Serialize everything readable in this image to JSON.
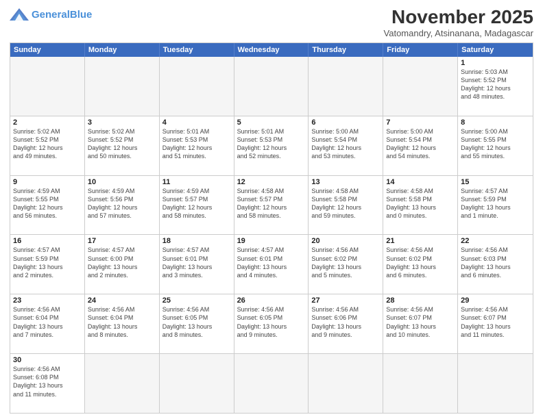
{
  "header": {
    "logo_general": "General",
    "logo_blue": "Blue",
    "month_title": "November 2025",
    "subtitle": "Vatomandry, Atsinanana, Madagascar"
  },
  "weekdays": [
    "Sunday",
    "Monday",
    "Tuesday",
    "Wednesday",
    "Thursday",
    "Friday",
    "Saturday"
  ],
  "rows": [
    [
      {
        "day": "",
        "info": ""
      },
      {
        "day": "",
        "info": ""
      },
      {
        "day": "",
        "info": ""
      },
      {
        "day": "",
        "info": ""
      },
      {
        "day": "",
        "info": ""
      },
      {
        "day": "",
        "info": ""
      },
      {
        "day": "1",
        "info": "Sunrise: 5:03 AM\nSunset: 5:52 PM\nDaylight: 12 hours\nand 48 minutes."
      }
    ],
    [
      {
        "day": "2",
        "info": "Sunrise: 5:02 AM\nSunset: 5:52 PM\nDaylight: 12 hours\nand 49 minutes."
      },
      {
        "day": "3",
        "info": "Sunrise: 5:02 AM\nSunset: 5:52 PM\nDaylight: 12 hours\nand 50 minutes."
      },
      {
        "day": "4",
        "info": "Sunrise: 5:01 AM\nSunset: 5:53 PM\nDaylight: 12 hours\nand 51 minutes."
      },
      {
        "day": "5",
        "info": "Sunrise: 5:01 AM\nSunset: 5:53 PM\nDaylight: 12 hours\nand 52 minutes."
      },
      {
        "day": "6",
        "info": "Sunrise: 5:00 AM\nSunset: 5:54 PM\nDaylight: 12 hours\nand 53 minutes."
      },
      {
        "day": "7",
        "info": "Sunrise: 5:00 AM\nSunset: 5:54 PM\nDaylight: 12 hours\nand 54 minutes."
      },
      {
        "day": "8",
        "info": "Sunrise: 5:00 AM\nSunset: 5:55 PM\nDaylight: 12 hours\nand 55 minutes."
      }
    ],
    [
      {
        "day": "9",
        "info": "Sunrise: 4:59 AM\nSunset: 5:55 PM\nDaylight: 12 hours\nand 56 minutes."
      },
      {
        "day": "10",
        "info": "Sunrise: 4:59 AM\nSunset: 5:56 PM\nDaylight: 12 hours\nand 57 minutes."
      },
      {
        "day": "11",
        "info": "Sunrise: 4:59 AM\nSunset: 5:57 PM\nDaylight: 12 hours\nand 58 minutes."
      },
      {
        "day": "12",
        "info": "Sunrise: 4:58 AM\nSunset: 5:57 PM\nDaylight: 12 hours\nand 58 minutes."
      },
      {
        "day": "13",
        "info": "Sunrise: 4:58 AM\nSunset: 5:58 PM\nDaylight: 12 hours\nand 59 minutes."
      },
      {
        "day": "14",
        "info": "Sunrise: 4:58 AM\nSunset: 5:58 PM\nDaylight: 13 hours\nand 0 minutes."
      },
      {
        "day": "15",
        "info": "Sunrise: 4:57 AM\nSunset: 5:59 PM\nDaylight: 13 hours\nand 1 minute."
      }
    ],
    [
      {
        "day": "16",
        "info": "Sunrise: 4:57 AM\nSunset: 5:59 PM\nDaylight: 13 hours\nand 2 minutes."
      },
      {
        "day": "17",
        "info": "Sunrise: 4:57 AM\nSunset: 6:00 PM\nDaylight: 13 hours\nand 2 minutes."
      },
      {
        "day": "18",
        "info": "Sunrise: 4:57 AM\nSunset: 6:01 PM\nDaylight: 13 hours\nand 3 minutes."
      },
      {
        "day": "19",
        "info": "Sunrise: 4:57 AM\nSunset: 6:01 PM\nDaylight: 13 hours\nand 4 minutes."
      },
      {
        "day": "20",
        "info": "Sunrise: 4:56 AM\nSunset: 6:02 PM\nDaylight: 13 hours\nand 5 minutes."
      },
      {
        "day": "21",
        "info": "Sunrise: 4:56 AM\nSunset: 6:02 PM\nDaylight: 13 hours\nand 6 minutes."
      },
      {
        "day": "22",
        "info": "Sunrise: 4:56 AM\nSunset: 6:03 PM\nDaylight: 13 hours\nand 6 minutes."
      }
    ],
    [
      {
        "day": "23",
        "info": "Sunrise: 4:56 AM\nSunset: 6:04 PM\nDaylight: 13 hours\nand 7 minutes."
      },
      {
        "day": "24",
        "info": "Sunrise: 4:56 AM\nSunset: 6:04 PM\nDaylight: 13 hours\nand 8 minutes."
      },
      {
        "day": "25",
        "info": "Sunrise: 4:56 AM\nSunset: 6:05 PM\nDaylight: 13 hours\nand 8 minutes."
      },
      {
        "day": "26",
        "info": "Sunrise: 4:56 AM\nSunset: 6:05 PM\nDaylight: 13 hours\nand 9 minutes."
      },
      {
        "day": "27",
        "info": "Sunrise: 4:56 AM\nSunset: 6:06 PM\nDaylight: 13 hours\nand 9 minutes."
      },
      {
        "day": "28",
        "info": "Sunrise: 4:56 AM\nSunset: 6:07 PM\nDaylight: 13 hours\nand 10 minutes."
      },
      {
        "day": "29",
        "info": "Sunrise: 4:56 AM\nSunset: 6:07 PM\nDaylight: 13 hours\nand 11 minutes."
      }
    ],
    [
      {
        "day": "30",
        "info": "Sunrise: 4:56 AM\nSunset: 6:08 PM\nDaylight: 13 hours\nand 11 minutes."
      },
      {
        "day": "",
        "info": ""
      },
      {
        "day": "",
        "info": ""
      },
      {
        "day": "",
        "info": ""
      },
      {
        "day": "",
        "info": ""
      },
      {
        "day": "",
        "info": ""
      },
      {
        "day": "",
        "info": ""
      }
    ]
  ]
}
